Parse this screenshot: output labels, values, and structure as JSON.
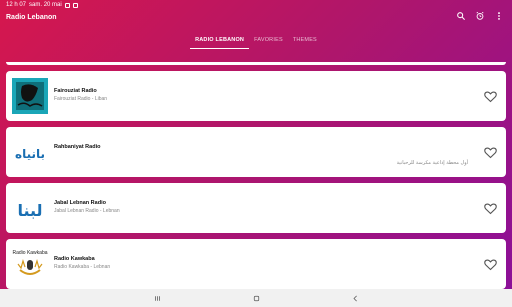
{
  "status_bar": {
    "time": "12 h 07",
    "date": "sam. 20 mai"
  },
  "app_bar": {
    "title": "Radio Lebanon",
    "icons": [
      "search-icon",
      "alarm-icon",
      "more-vert-icon"
    ]
  },
  "tabs": [
    {
      "label": "RADIO LEBANON",
      "active": true
    },
    {
      "label": "FAVORIES",
      "active": false
    },
    {
      "label": "THEMES",
      "active": false
    }
  ],
  "stations": [
    {
      "title": "Fairouziat Radio",
      "subtitle": "Fairouziat Radio - Liban",
      "arabic": "",
      "favorite": false
    },
    {
      "title": "Rahbaniyat Radio",
      "subtitle": "",
      "arabic": "أول محطة إذاعية مكرسة للرحبانية",
      "logo_text": "بانياه",
      "favorite": false
    },
    {
      "title": "Jabal Lebnan Radio",
      "subtitle": "Jabal Lebnan Radio - Lebnan",
      "arabic": "",
      "logo_text": "لبنا",
      "favorite": false
    },
    {
      "title": "Radio Kawkaba",
      "subtitle": "Radio Kawkaba - Lebnan",
      "arabic": "",
      "logo_text": "Radio Kawkaba",
      "favorite": false
    }
  ],
  "colors": {
    "gradient_start": "#d6174d",
    "gradient_end": "#8a0f9a",
    "logo_blue": "#1a6fb3"
  }
}
